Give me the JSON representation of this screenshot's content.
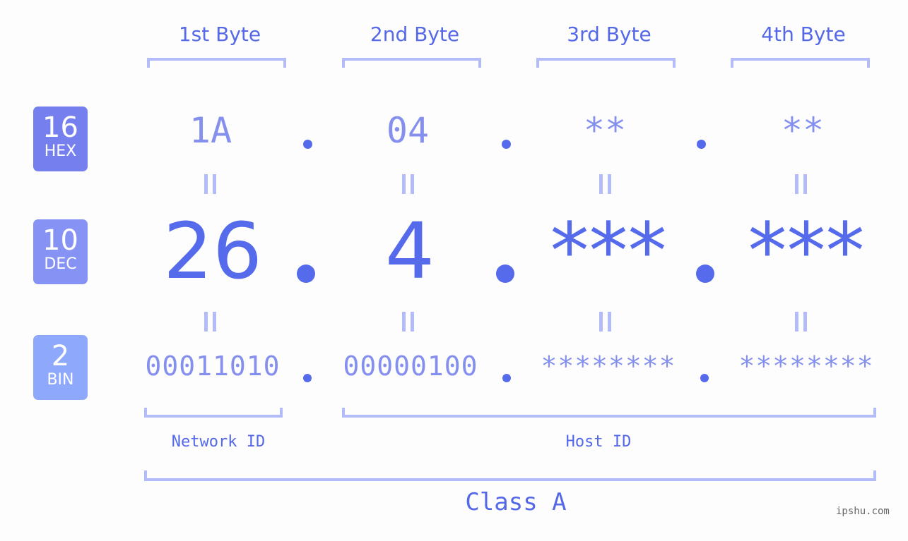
{
  "byte_headers": [
    "1st Byte",
    "2nd Byte",
    "3rd Byte",
    "4th Byte"
  ],
  "badges": [
    {
      "number": "16",
      "label": "HEX",
      "color": "#7580ee"
    },
    {
      "number": "10",
      "label": "DEC",
      "color": "#8693f4"
    },
    {
      "number": "2",
      "label": "BIN",
      "color": "#8ea9fb"
    }
  ],
  "hex_values": [
    "1A",
    "04",
    "**",
    "**"
  ],
  "dec_values": [
    "26",
    "4",
    "***",
    "***"
  ],
  "bin_values": [
    "00011010",
    "00000100",
    "********",
    "********"
  ],
  "equals_symbol": "=",
  "separator": ".",
  "network_label": "Network ID",
  "host_label": "Host ID",
  "class_label": "Class A",
  "watermark": "ipshu.com",
  "colors": {
    "primary": "#566bec",
    "light": "#8590ee",
    "bracket": "#b3bcf8",
    "background": "#fcfdfc"
  }
}
